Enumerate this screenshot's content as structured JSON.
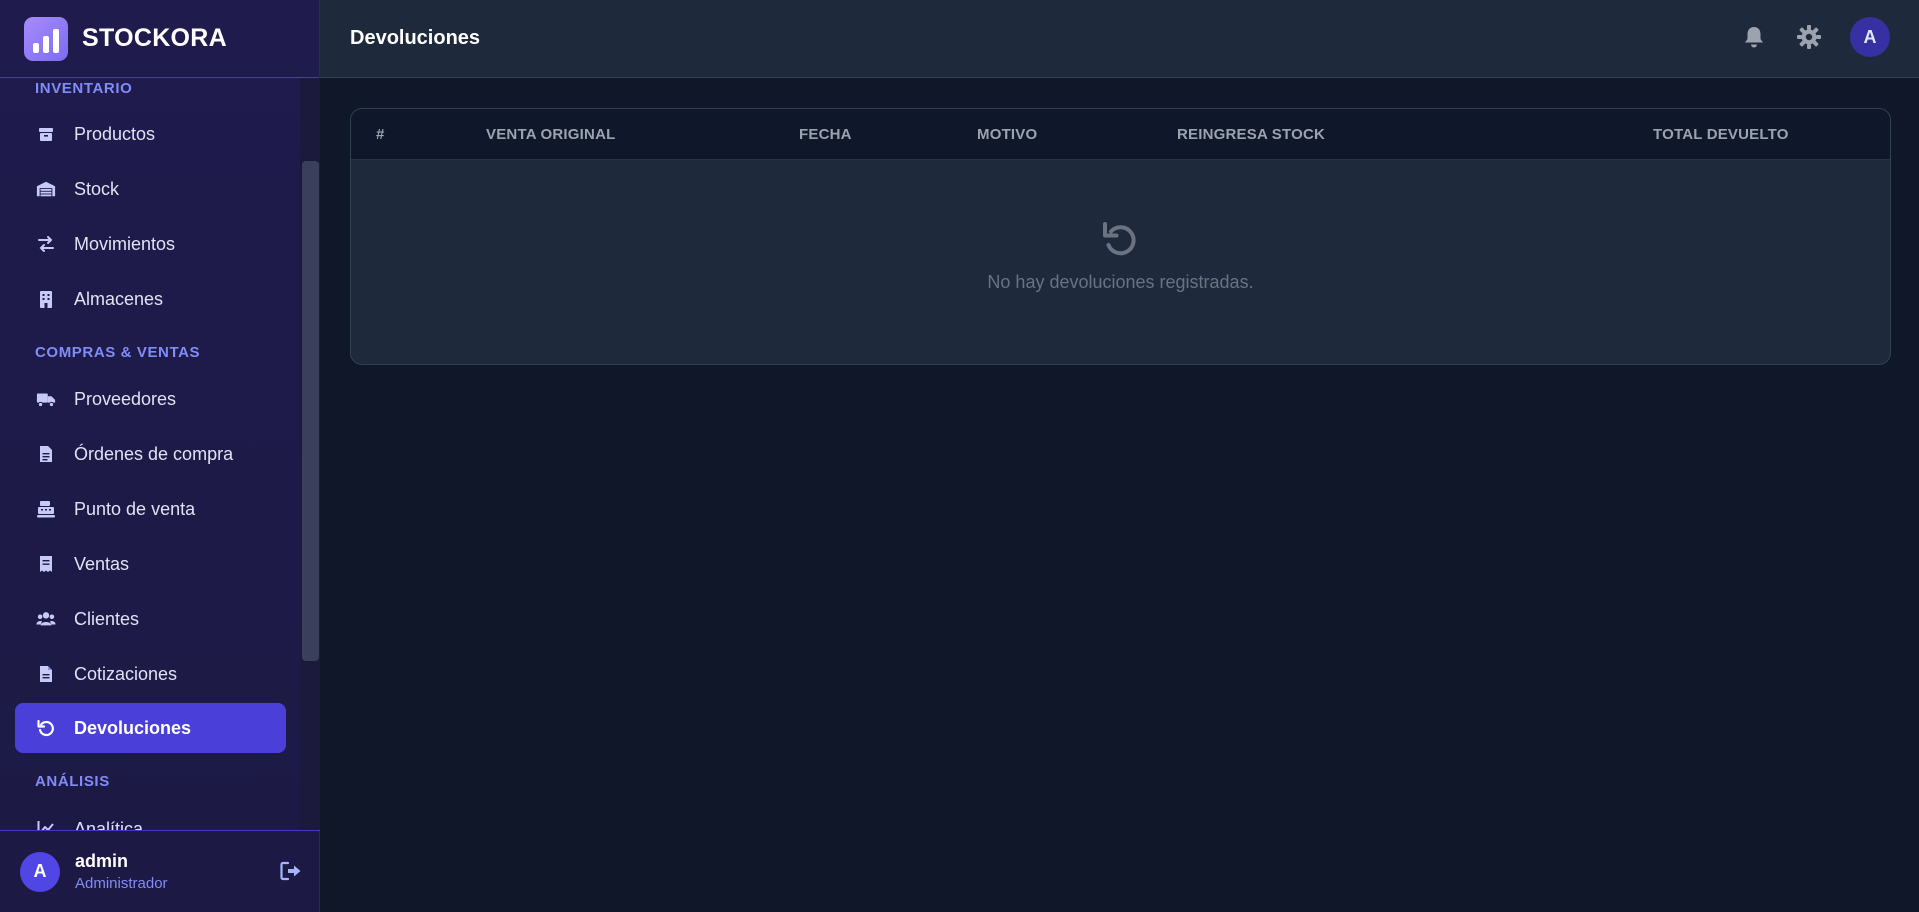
{
  "brand": {
    "name": "STOCKORA"
  },
  "sidebar": {
    "sections": [
      {
        "title": "INVENTARIO"
      },
      {
        "title": "COMPRAS & VENTAS"
      },
      {
        "title": "ANÁLISIS"
      }
    ],
    "items": [
      {
        "label": "Productos",
        "icon": "box-icon"
      },
      {
        "label": "Stock",
        "icon": "warehouse-icon"
      },
      {
        "label": "Movimientos",
        "icon": "arrows-exchange-icon"
      },
      {
        "label": "Almacenes",
        "icon": "building-icon"
      },
      {
        "label": "Proveedores",
        "icon": "truck-icon"
      },
      {
        "label": "Órdenes de compra",
        "icon": "document-icon"
      },
      {
        "label": "Punto de venta",
        "icon": "cash-register-icon"
      },
      {
        "label": "Ventas",
        "icon": "receipt-icon"
      },
      {
        "label": "Clientes",
        "icon": "users-icon"
      },
      {
        "label": "Cotizaciones",
        "icon": "file-icon"
      },
      {
        "label": "Devoluciones",
        "icon": "undo-icon",
        "active": true
      },
      {
        "label": "Analítica",
        "icon": "chart-line-icon"
      }
    ]
  },
  "user": {
    "initial": "A",
    "name": "admin",
    "role": "Administrador"
  },
  "header": {
    "title": "Devoluciones",
    "avatar_initial": "A"
  },
  "table": {
    "columns": [
      "#",
      "VENTA ORIGINAL",
      "FECHA",
      "MOTIVO",
      "REINGRESA STOCK",
      "TOTAL DEVUELTO"
    ],
    "empty_message": "No hay devoluciones registradas."
  },
  "colors": {
    "accent": "#4a3fd8",
    "sidebar_bg": "#1f1b4d",
    "main_bg": "#0f1729",
    "section_title": "#818cf8"
  }
}
